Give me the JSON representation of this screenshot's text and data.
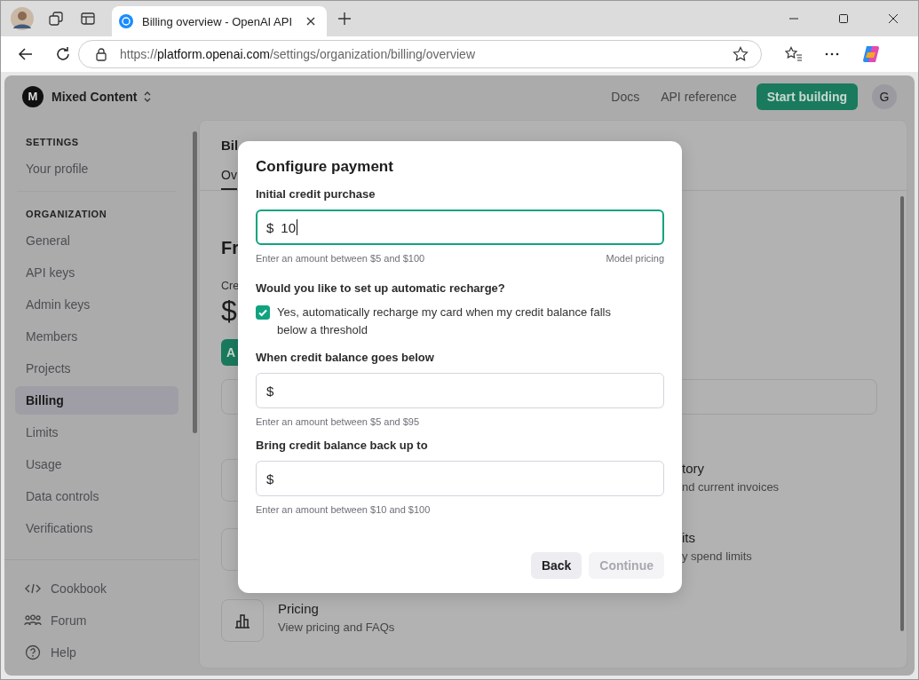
{
  "browser": {
    "tabs": [
      {
        "title": "Billing overview - OpenAI API",
        "selected": true
      }
    ],
    "url": {
      "scheme": "https://",
      "host": "platform.openai.com",
      "path": "/settings/organization/billing/overview"
    }
  },
  "header": {
    "org_initial": "M",
    "org_name": "Mixed Content",
    "links": [
      "Docs",
      "API reference"
    ],
    "primary_button": "Start building",
    "avatar": "G"
  },
  "sidebar": {
    "sections": [
      {
        "heading": "SETTINGS",
        "items": [
          {
            "label": "Your profile",
            "selected": false
          }
        ]
      },
      {
        "heading": "ORGANIZATION",
        "items": [
          {
            "label": "General",
            "selected": false
          },
          {
            "label": "API keys",
            "selected": false
          },
          {
            "label": "Admin keys",
            "selected": false
          },
          {
            "label": "Members",
            "selected": false
          },
          {
            "label": "Projects",
            "selected": false
          },
          {
            "label": "Billing",
            "selected": true
          },
          {
            "label": "Limits",
            "selected": false
          },
          {
            "label": "Usage",
            "selected": false
          },
          {
            "label": "Data controls",
            "selected": false
          },
          {
            "label": "Verifications",
            "selected": false
          }
        ]
      }
    ],
    "footer": [
      {
        "label": "Cookbook",
        "kind": "code"
      },
      {
        "label": "Forum",
        "kind": "people"
      },
      {
        "label": "Help",
        "kind": "help"
      }
    ]
  },
  "background": {
    "title": "Bil",
    "tab": "Ov",
    "heading": "Fr",
    "credit_label": "Cre",
    "balance": "$",
    "add_button": "A",
    "cards": [
      {
        "title": "tory",
        "description": "nd current invoices"
      },
      {
        "title": "its",
        "description": "y spend limits"
      }
    ],
    "pricing": {
      "title": "Pricing",
      "description": "View pricing and FAQs"
    }
  },
  "modal": {
    "title": "Configure payment",
    "purchase": {
      "label": "Initial credit purchase",
      "prefix": "$",
      "value": "10",
      "focused": true,
      "hint": "Enter an amount between $5 and $100",
      "link": "Model pricing"
    },
    "question": "Would you like to set up automatic recharge?",
    "recharge": {
      "label": "Yes, automatically recharge my card when my credit balance falls below a threshold",
      "checked": true
    },
    "fields": [
      {
        "label": "When credit balance goes below",
        "prefix": "$",
        "hint": "Enter an amount between $5 and $95"
      },
      {
        "label": "Bring credit balance back up to",
        "prefix": "$",
        "hint": "Enter an amount between $10 and $100"
      }
    ],
    "buttons": [
      {
        "label": "Back",
        "disabled": false
      },
      {
        "label": "Continue",
        "disabled": true
      }
    ]
  }
}
